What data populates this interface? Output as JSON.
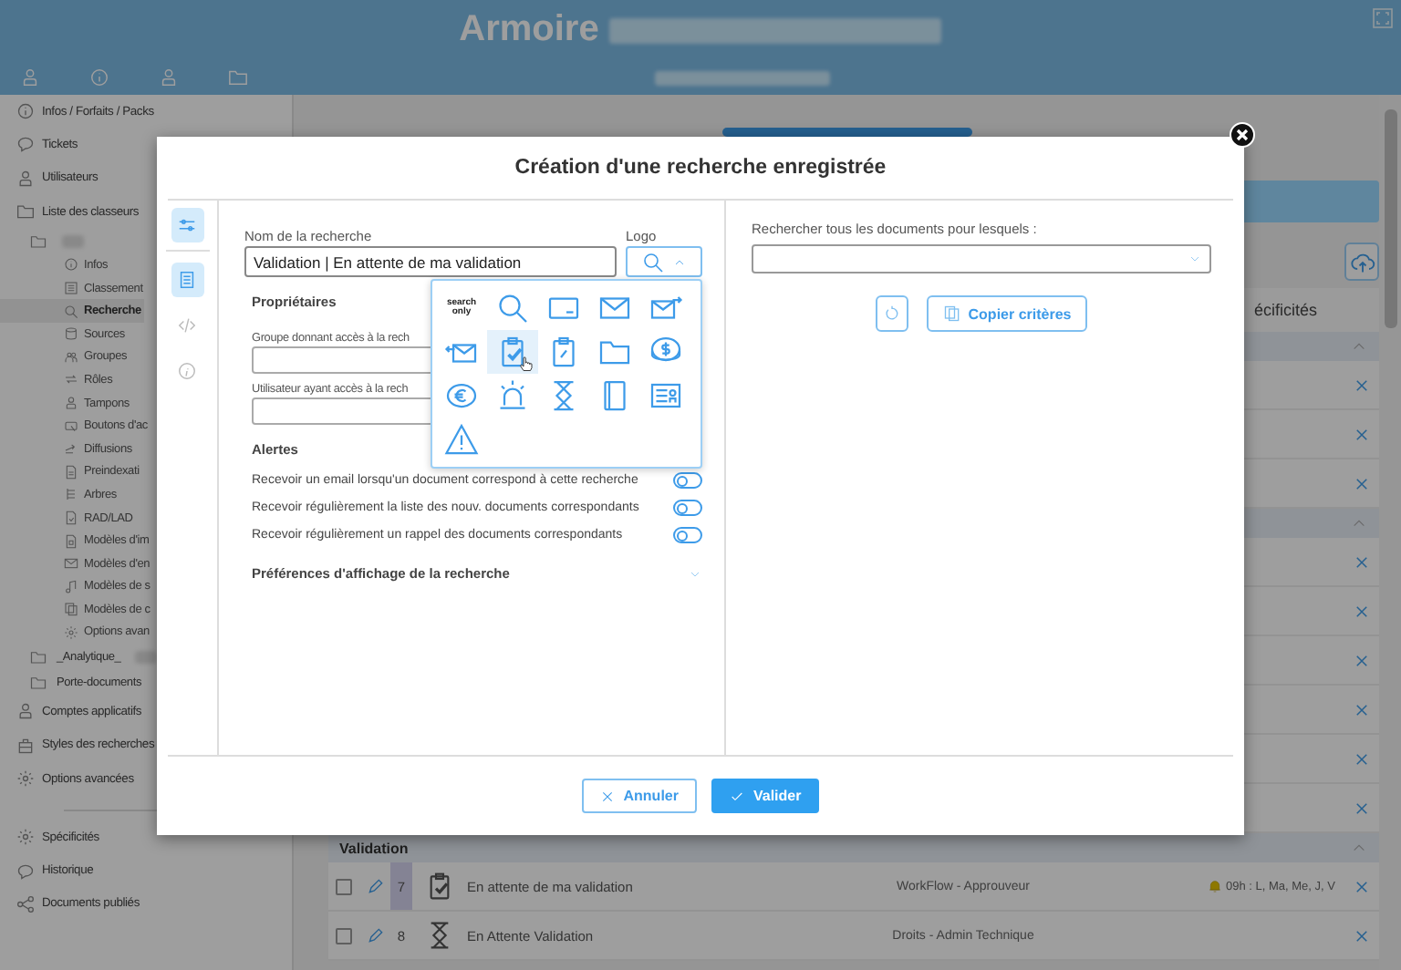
{
  "header": {
    "title": "Armoire"
  },
  "sidebar": {
    "items": [
      {
        "label": "Infos / Forfaits / Packs"
      },
      {
        "label": "Tickets"
      },
      {
        "label": "Utilisateurs"
      },
      {
        "label": "Liste des classeurs",
        "children": [
          {
            "redacted": true,
            "children": [
              {
                "label": "Infos",
                "selected": false
              },
              {
                "label": "Classement",
                "selected": false
              },
              {
                "label": "Recherche",
                "selected": true
              },
              {
                "label": "Sources",
                "selected": false
              },
              {
                "label": "Groupes",
                "selected": false
              },
              {
                "label": "Rôles",
                "selected": false
              },
              {
                "label": "Tampons",
                "selected": false
              },
              {
                "label": "Boutons d'ac",
                "selected": false
              },
              {
                "label": "Diffusions",
                "selected": false
              },
              {
                "label": "Preindexati",
                "selected": false
              },
              {
                "label": "Arbres",
                "selected": false
              },
              {
                "label": "RAD/LAD",
                "selected": false
              },
              {
                "label": "Modèles d'im",
                "selected": false
              },
              {
                "label": "Modèles d'en",
                "selected": false
              },
              {
                "label": "Modèles de s",
                "selected": false
              },
              {
                "label": "Modèles de c",
                "selected": false
              },
              {
                "label": "Options avan",
                "selected": false
              }
            ]
          },
          {
            "label": "_Analytique_",
            "redacted": true
          },
          {
            "label": "Porte-documents",
            "redacted": false
          }
        ]
      },
      {
        "label": "Comptes applicatifs"
      },
      {
        "label": "Styles des recherches"
      },
      {
        "label": "Options avancées"
      }
    ],
    "bottom_items": [
      {
        "label": "Spécificités"
      },
      {
        "label": "Historique"
      },
      {
        "label": "Documents publiés"
      }
    ]
  },
  "main": {
    "tab_label": "écificités",
    "groups": [
      {
        "expanded": true,
        "rows": [
          {
            "removable": true
          },
          {
            "removable": true
          },
          {
            "removable": true
          }
        ]
      },
      {
        "expanded": true,
        "rows": [
          {
            "removable": true
          },
          {
            "removable": true
          },
          {
            "removable": true
          },
          {
            "removable": true
          },
          {
            "removable": true
          },
          {
            "removable": true
          }
        ]
      },
      {
        "title": "Validation",
        "expanded": true,
        "rows": [
          {
            "checked": false,
            "number": "7",
            "selected": true,
            "name": "En attente de ma validation",
            "rights": "WorkFlow - Approuveur",
            "schedule": "09h : L, Ma, Me, J, V",
            "removable": true
          },
          {
            "checked": false,
            "number": "8",
            "selected": false,
            "name": "En Attente Validation",
            "rights": "Droits - Admin Technique",
            "removable": true
          }
        ]
      }
    ]
  },
  "dialog": {
    "title": "Création d'une recherche enregistrée",
    "rail": [
      {
        "selected": true
      },
      {
        "selected": true
      },
      {
        "selected": false
      },
      {
        "selected": false
      }
    ],
    "name_field": {
      "label": "Nom de la recherche",
      "value": "Validation | En attente de ma validation"
    },
    "logo": {
      "label": "Logo",
      "expanded": true,
      "options": [
        {
          "label": "search only",
          "selected": false
        },
        {
          "selected": false
        },
        {
          "selected": false
        },
        {
          "selected": false
        },
        {
          "selected": false
        },
        {
          "selected": false
        },
        {
          "selected": true
        },
        {
          "selected": false
        },
        {
          "selected": false
        },
        {
          "selected": false
        },
        {
          "selected": false
        },
        {
          "selected": false
        },
        {
          "selected": false
        },
        {
          "selected": false
        },
        {
          "selected": false
        },
        {
          "selected": false
        }
      ]
    },
    "owners": {
      "title": "Propriétaires",
      "fields": [
        {
          "label": "Groupe donnant accès à la rech"
        },
        {
          "label": "Utilisateur ayant accès à la rech"
        }
      ]
    },
    "alerts": {
      "title": "Alertes",
      "toggles": [
        {
          "label": "Recevoir un email lorsqu'un document correspond à cette recherche",
          "on": false
        },
        {
          "label": "Recevoir régulièrement la liste des nouv. documents correspondants",
          "on": false
        },
        {
          "label": "Recevoir régulièrement un rappel des documents correspondants",
          "on": false
        }
      ]
    },
    "display_prefs": {
      "title": "Préférences d'affichage de la recherche",
      "expanded": false
    },
    "criteria": {
      "label": "Rechercher tous les documents pour lesquels :",
      "buttons": [
        {
          "kind": "reset"
        },
        {
          "kind": "copy",
          "label": "Copier critères"
        }
      ]
    },
    "footer_buttons": [
      {
        "kind": "secondary",
        "label": "Annuler"
      },
      {
        "kind": "primary",
        "label": "Valider"
      }
    ]
  }
}
